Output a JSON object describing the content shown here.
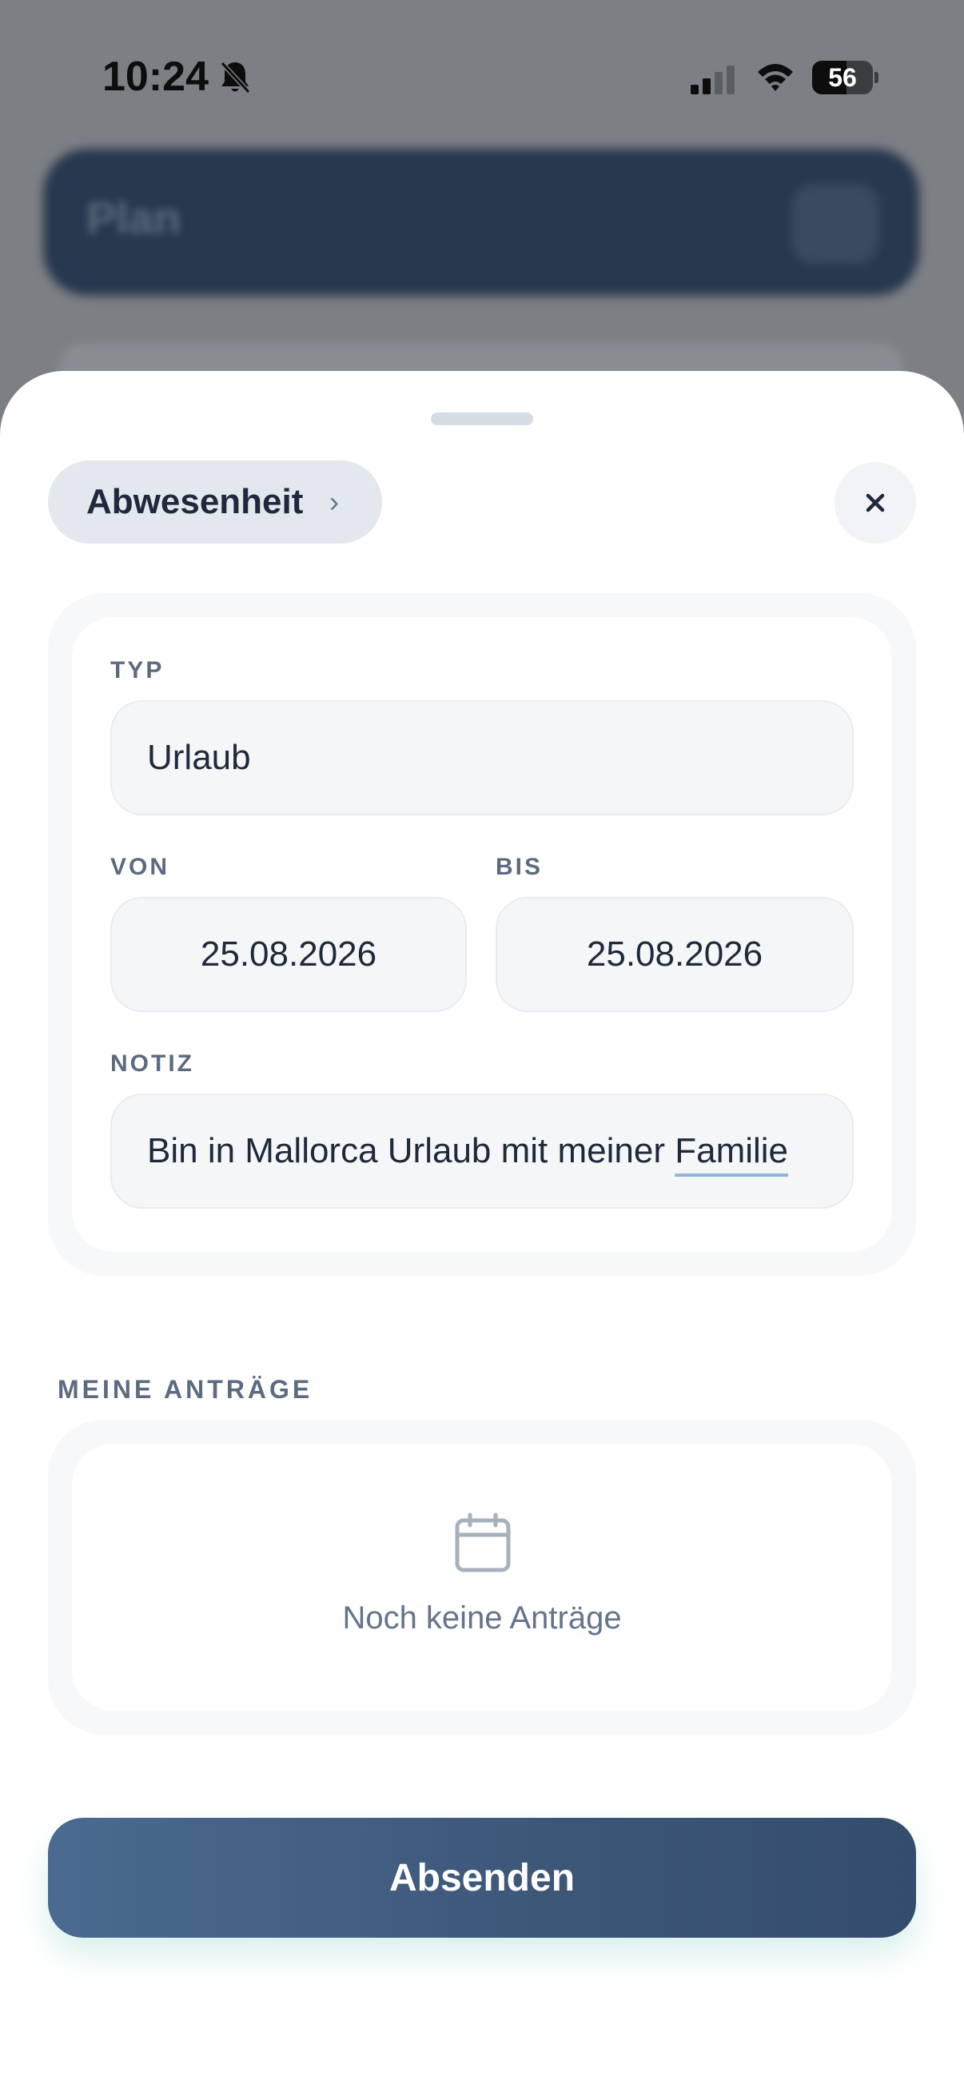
{
  "status_bar": {
    "time": "10:24",
    "battery": "56",
    "battery_level_percent": 56,
    "icons": [
      "bell-slash-icon",
      "cellular-signal-icon",
      "wifi-icon",
      "battery-icon"
    ]
  },
  "background": {
    "header_title": "Plan"
  },
  "sheet": {
    "type_chip": {
      "label": "Abwesenheit",
      "chevron": "›"
    },
    "close_icon": "close-icon",
    "form": {
      "type_label": "TYP",
      "type_value": "Urlaub",
      "from_label": "VON",
      "from_value": "25.08.2026",
      "to_label": "BIS",
      "to_value": "25.08.2026",
      "note_label": "NOTIZ",
      "note_value_prefix": "Bin in Mallorca Urlaub mit meiner ",
      "note_value_last_word": "Familie"
    },
    "requests": {
      "section_label": "MEINE ANTRÄGE",
      "empty_icon": "calendar-icon",
      "empty_text": "Noch keine Anträge"
    },
    "submit_label": "Absenden"
  },
  "colors": {
    "accent": "#3f5b7e",
    "chip_bg": "#e3e8ee",
    "text_primary": "#1e293b",
    "text_muted": "#5b6b80"
  }
}
